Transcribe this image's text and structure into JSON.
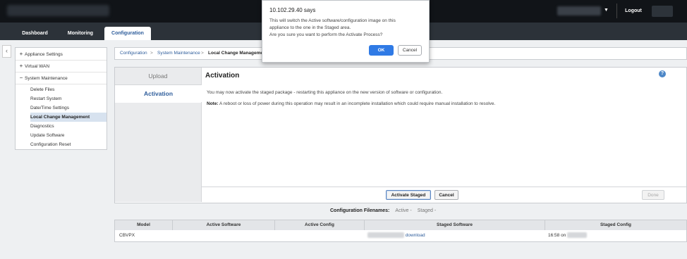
{
  "header": {
    "logout_label": "Logout",
    "user_caret": "▼"
  },
  "nav": {
    "tabs": [
      "Dashboard",
      "Monitoring",
      "Configuration"
    ],
    "active_tab": "Configuration"
  },
  "sidebar": {
    "collapse_icon": "chevron-left-icon",
    "sections": [
      {
        "sign": "+",
        "label": "Appliance Settings"
      },
      {
        "sign": "+",
        "label": "Virtual WAN"
      },
      {
        "sign": "−",
        "label": "System Maintenance"
      }
    ],
    "items": [
      "Delete Files",
      "Restart System",
      "Date/Time Settings",
      "Local Change Management",
      "Diagnostics",
      "Update Software",
      "Configuration Reset"
    ],
    "selected_item": "Local Change Management"
  },
  "breadcrumb": {
    "items": [
      "Configuration",
      "System Maintenance",
      "Local Change Management"
    ],
    "separator": ">"
  },
  "panel": {
    "tabs": [
      "Upload",
      "Activation"
    ],
    "active_tab": "Activation",
    "title": "Activation",
    "help_icon": "?",
    "description": "You may now activate the staged package - restarting this appliance on the new version of software or configuration.",
    "note_label": "Note:",
    "note_text": " A reboot or loss of power during this operation may result in an incomplete installation which could require manual installation to resolve.",
    "buttons": {
      "activate": "Activate Staged",
      "cancel": "Cancel",
      "done": "Done"
    }
  },
  "config_files": {
    "label": "Configuration Filenames:",
    "active": "Active -",
    "staged": "Staged -"
  },
  "table": {
    "columns": [
      "Model",
      "Active Software",
      "Active Config",
      "Staged Software",
      "Staged Config"
    ],
    "row": {
      "model": "CBVPX",
      "staged_software_link": "download",
      "staged_config_time": "16:58 on"
    }
  },
  "dialog": {
    "title": "10.102.29.40 says",
    "lines": [
      "This will switch the Active software/configuration image on this",
      "appliance to the one in the Staged area.",
      "Are you sure you want to perform the Activate Process?"
    ],
    "ok_label": "OK",
    "cancel_label": "Cancel"
  },
  "colors": {
    "accent": "#2e5d9b",
    "dialog_ok": "#2f7ae5",
    "topbar": "#111418",
    "navbar": "#2c3239"
  }
}
